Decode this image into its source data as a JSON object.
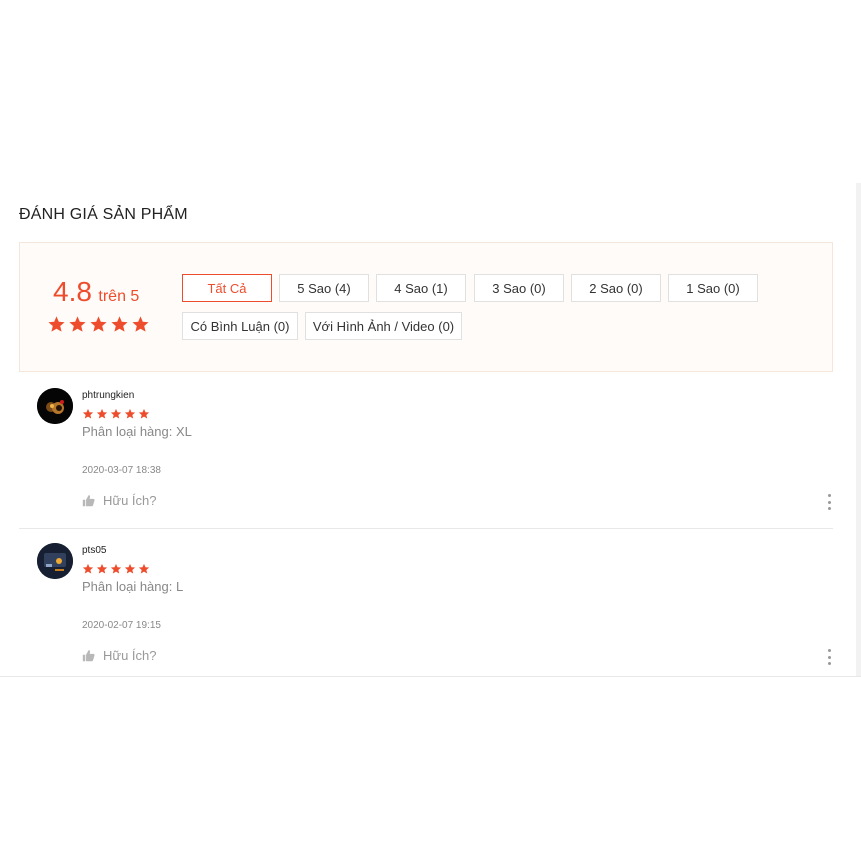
{
  "title": "ĐÁNH GIÁ SẢN PHẨM",
  "overview": {
    "score": "4.8",
    "out_of": "trên 5",
    "rating_stars": 5,
    "filters": [
      {
        "label": "Tất Cả",
        "active": true
      },
      {
        "label": "5 Sao (4)",
        "active": false
      },
      {
        "label": "4 Sao (1)",
        "active": false
      },
      {
        "label": "3 Sao (0)",
        "active": false
      },
      {
        "label": "2 Sao (0)",
        "active": false
      },
      {
        "label": "1 Sao (0)",
        "active": false
      },
      {
        "label": "Có Bình Luận (0)",
        "active": false
      },
      {
        "label": "Với Hình Ảnh / Video (0)",
        "active": false
      }
    ]
  },
  "reviews": [
    {
      "username": "phtrungkien",
      "stars": 5,
      "variation": "Phân loại hàng: XL",
      "time": "2020-03-07 18:38",
      "helpful": "Hữu Ích?"
    },
    {
      "username": "pts05",
      "stars": 5,
      "variation": "Phân loại hàng: L",
      "time": "2020-02-07 19:15",
      "helpful": "Hữu Ích?"
    }
  ],
  "colors": {
    "accent": "#ee4d2d",
    "muted": "#888888"
  },
  "icons": {
    "star": "star-icon",
    "thumb": "thumb-up-icon",
    "more": "more-vertical-icon"
  }
}
